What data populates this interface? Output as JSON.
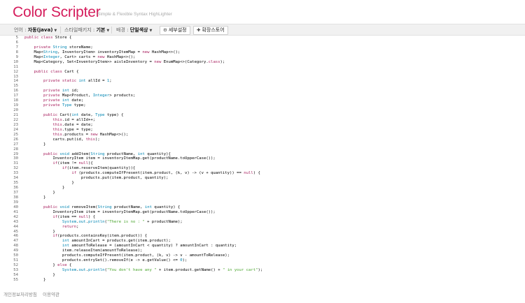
{
  "brand": {
    "title": "Color Scripter",
    "tagline": "Simple & Flexible Syntax HighLighter"
  },
  "toolbar": {
    "language_label": "언어 :",
    "language_value": "자동(java)",
    "style_label": "스타일패키지 :",
    "style_value": "기본",
    "background_label": "배경 :",
    "background_value": "단일색상",
    "detail_settings_label": "세부설정",
    "extension_label": "확장스토어"
  },
  "icons": {
    "dropdown": "chevron-down-icon",
    "settings": "gear-icon",
    "extension": "puzzle-icon"
  },
  "colors": {
    "brand": "#d51d5c",
    "keyword": "#a71d5d",
    "type": "#0086b3",
    "string": "#4aa52e",
    "toolbar_bg": "#f1f1f1"
  },
  "code": {
    "lines": [
      {
        "n": "5",
        "text": "public class Store {"
      },
      {
        "n": "6",
        "text": ""
      },
      {
        "n": "7",
        "text": "    private String storeName;"
      },
      {
        "n": "8",
        "text": "    Map<String, InventoryItem> inventoryItemMap = new HashMap<>();"
      },
      {
        "n": "9",
        "text": "    Map<Integer, Cart> carts = new HashMap<>();"
      },
      {
        "n": "10",
        "text": "    Map<Category, Set<InventoryItem>> aisleInventory = new EnumMap<>(Category.class);"
      },
      {
        "n": "11",
        "text": ""
      },
      {
        "n": "12",
        "text": "    public class Cart {"
      },
      {
        "n": "13",
        "text": ""
      },
      {
        "n": "14",
        "text": "        private static int allId = 1;"
      },
      {
        "n": "15",
        "text": ""
      },
      {
        "n": "16",
        "text": "        private int id;"
      },
      {
        "n": "17",
        "text": "        private Map<Product, Integer> products;"
      },
      {
        "n": "18",
        "text": "        private int date;"
      },
      {
        "n": "19",
        "text": "        private Type type;"
      },
      {
        "n": "20",
        "text": ""
      },
      {
        "n": "21",
        "text": "        public Cart(int date, Type type) {"
      },
      {
        "n": "22",
        "text": "            this.id = allId++;"
      },
      {
        "n": "23",
        "text": "            this.date = date;"
      },
      {
        "n": "24",
        "text": "            this.type = type;"
      },
      {
        "n": "25",
        "text": "            this.products = new HashMap<>();"
      },
      {
        "n": "26",
        "text": "            carts.put(id, this);"
      },
      {
        "n": "27",
        "text": "        }"
      },
      {
        "n": "28",
        "text": ""
      },
      {
        "n": "29",
        "text": "        public void addItem(String productName, int quantity){"
      },
      {
        "n": "30",
        "text": "            InventoryItem item = inventoryItemMap.get(productName.toUpperCase());"
      },
      {
        "n": "31",
        "text": "            if(item != null){"
      },
      {
        "n": "32",
        "text": "                if(item.reserveItem(quantity)){"
      },
      {
        "n": "33",
        "text": "                    if (products.computeIfPresent(item.product, (k, v) -> (v + quantity)) == null) {"
      },
      {
        "n": "34",
        "text": "                        products.put(item.product, quantity);"
      },
      {
        "n": "35",
        "text": "                    }"
      },
      {
        "n": "36",
        "text": "                }"
      },
      {
        "n": "37",
        "text": "            }"
      },
      {
        "n": "38",
        "text": "        }"
      },
      {
        "n": "39",
        "text": ""
      },
      {
        "n": "40",
        "text": "        public void removeItem(String productName, int quantity) {"
      },
      {
        "n": "41",
        "text": "            InventoryItem item = inventoryItemMap.get(productName.toUpperCase());"
      },
      {
        "n": "42",
        "text": "            if(item == null) {"
      },
      {
        "n": "43",
        "text": "                System.out.println(\"There is no : \" + productName);"
      },
      {
        "n": "44",
        "text": "                return;"
      },
      {
        "n": "45",
        "text": "            }"
      },
      {
        "n": "46",
        "text": "            if(products.containsKey(item.product)) {"
      },
      {
        "n": "47",
        "text": "                int amountInCart = products.get(item.product);"
      },
      {
        "n": "48",
        "text": "                int amountToRelease = (amountInCart < quantity) ? amountInCart : quantity;"
      },
      {
        "n": "49",
        "text": "                item.releaseItem(amountToRelease);"
      },
      {
        "n": "50",
        "text": "                products.computeIfPresent(item.product, (k, v) -> v - amountToRelease);"
      },
      {
        "n": "51",
        "text": "                products.entrySet().removeIf(e -> e.getValue() <= 0);"
      },
      {
        "n": "52",
        "text": "            } else {"
      },
      {
        "n": "53",
        "text": "                System.out.println(\"You don't have any \" + item.product.getName() + \" in your cart\");"
      },
      {
        "n": "54",
        "text": "            }"
      },
      {
        "n": "55",
        "text": "        }"
      }
    ]
  },
  "footer": {
    "privacy_label": "개인정보처리방침",
    "terms_label": "이용약관"
  }
}
